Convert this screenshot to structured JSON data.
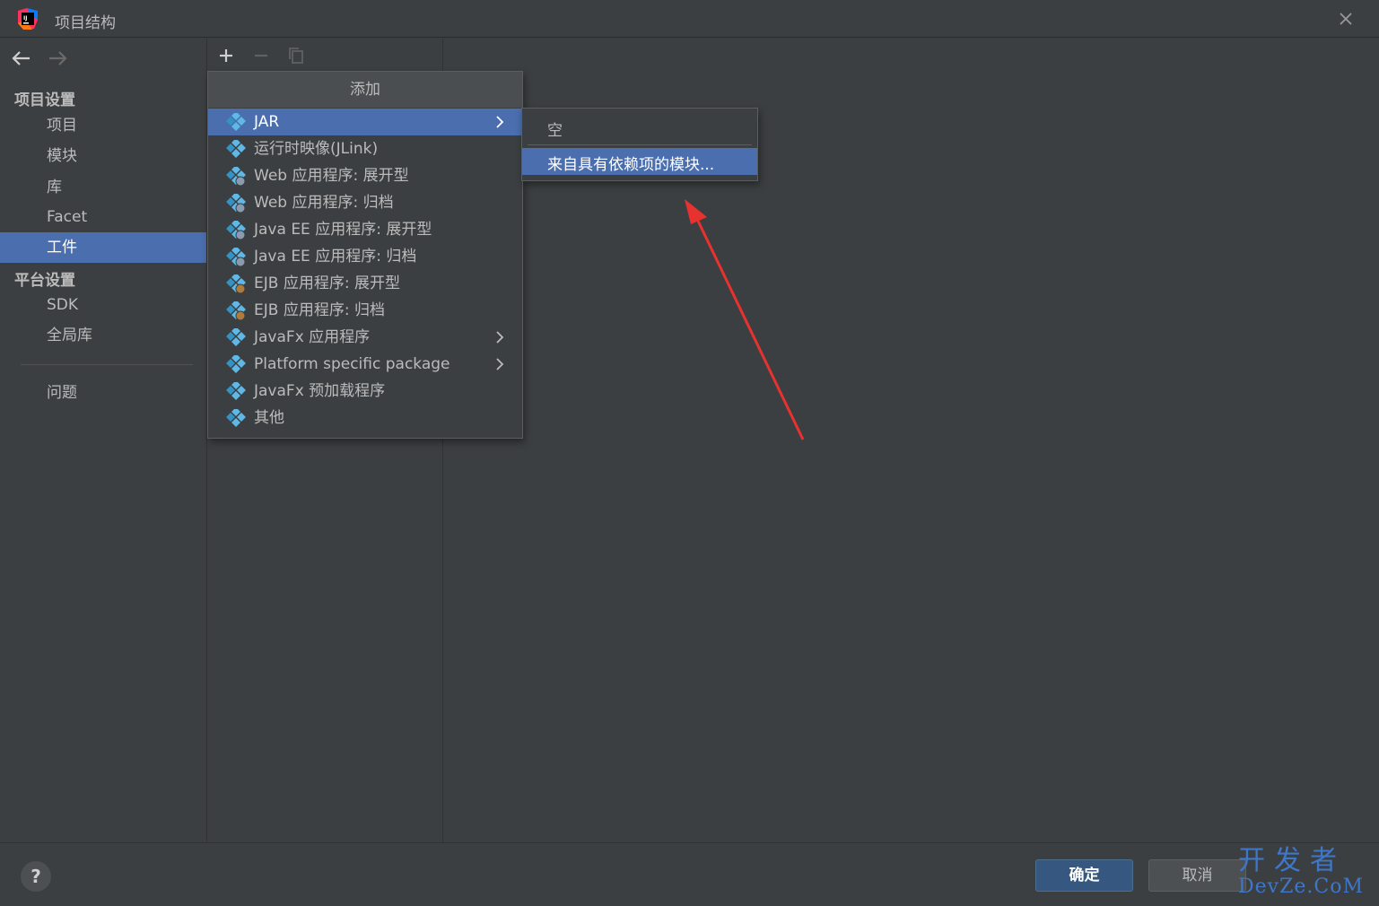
{
  "window": {
    "title": "项目结构"
  },
  "sidebar": {
    "project_settings_header": "项目设置",
    "project_items": [
      "项目",
      "模块",
      "库",
      "Facet",
      "工件"
    ],
    "platform_settings_header": "平台设置",
    "platform_items": [
      "SDK",
      "全局库"
    ],
    "problems": "问题",
    "selected": "工件"
  },
  "popup": {
    "header": "添加",
    "items": [
      {
        "label": "JAR",
        "icon": "jar-diamond-icon",
        "has_submenu": true,
        "selected": true
      },
      {
        "label": "运行时映像(JLink)",
        "icon": "diamond-icon"
      },
      {
        "label": "Web 应用程序: 展开型",
        "icon": "web-diamond-icon"
      },
      {
        "label": "Web 应用程序: 归档",
        "icon": "web-diamond-icon"
      },
      {
        "label": "Java EE 应用程序: 展开型",
        "icon": "javaee-diamond-icon"
      },
      {
        "label": "Java EE 应用程序: 归档",
        "icon": "javaee-diamond-icon"
      },
      {
        "label": "EJB 应用程序: 展开型",
        "icon": "ejb-diamond-icon"
      },
      {
        "label": "EJB 应用程序: 归档",
        "icon": "ejb-diamond-icon"
      },
      {
        "label": "JavaFx 应用程序",
        "icon": "diamond-icon",
        "has_submenu": true
      },
      {
        "label": "Platform specific package",
        "icon": "diamond-icon",
        "has_submenu": true
      },
      {
        "label": "JavaFx 预加载程序",
        "icon": "diamond-icon"
      },
      {
        "label": "其他",
        "icon": "diamond-icon"
      }
    ]
  },
  "submenu": {
    "items": [
      {
        "label": "空"
      },
      {
        "label": "来自具有依赖项的模块...",
        "selected": true
      }
    ]
  },
  "footer": {
    "help": "?",
    "ok": "确定",
    "cancel": "取消"
  },
  "watermark": {
    "line1": "开发者",
    "line2": "DevZe.CoM"
  },
  "colors": {
    "background": "#3c3f41",
    "selection": "#4b6eaf",
    "ok_button": "#365880",
    "annotation_arrow": "#e8322f",
    "watermark": "#3f77c8"
  }
}
